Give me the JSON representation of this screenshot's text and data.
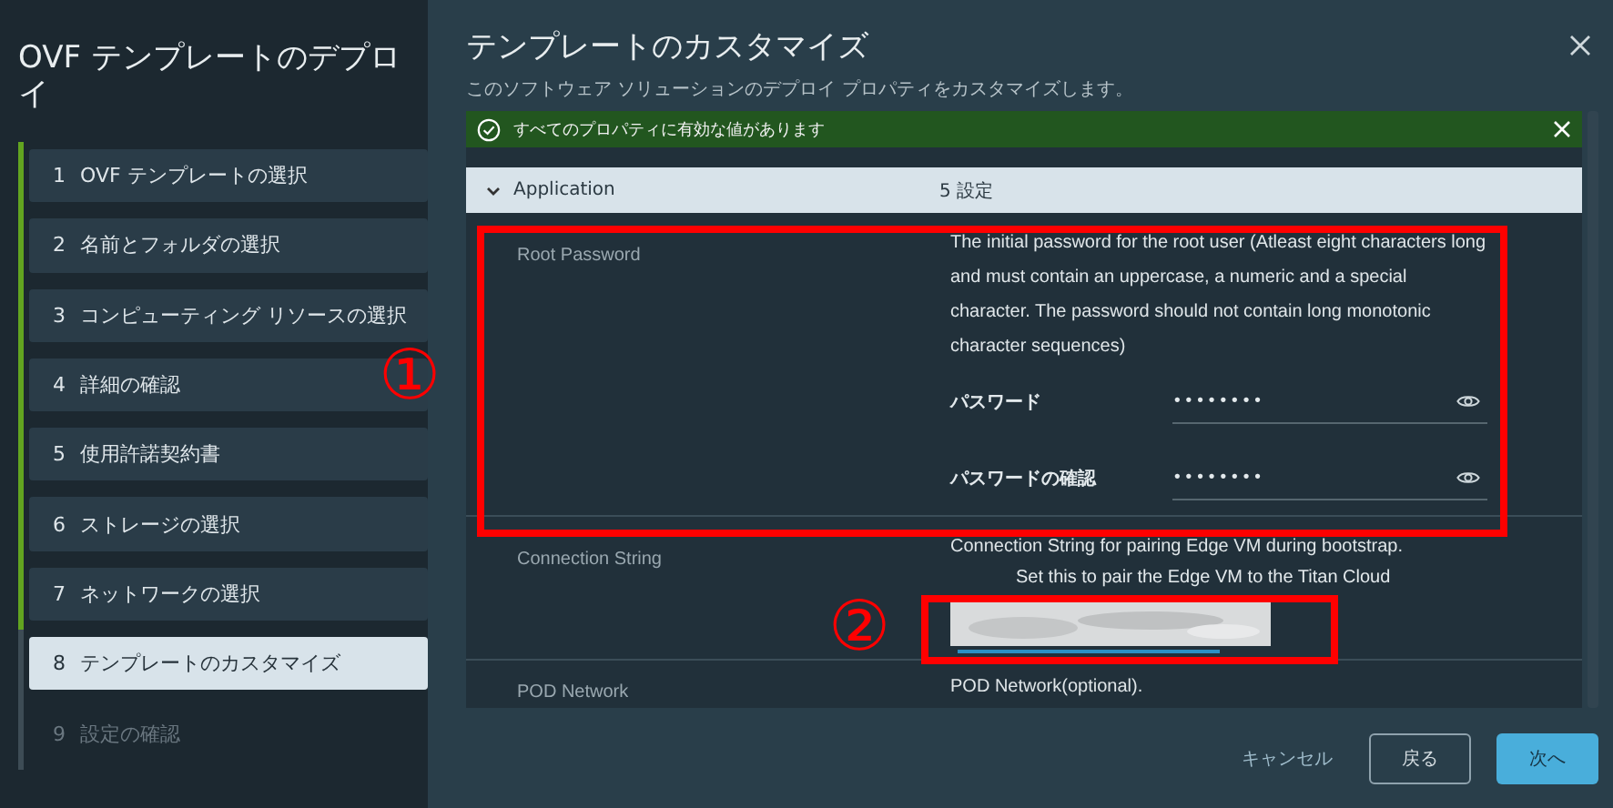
{
  "wizard": {
    "title": "OVF テンプレートのデプロイ",
    "steps": [
      {
        "number": "1",
        "label": "OVF テンプレートの選択",
        "selected": false,
        "completed": true,
        "disabled": false
      },
      {
        "number": "2",
        "label": "名前とフォルダの選択",
        "selected": false,
        "completed": true,
        "disabled": false
      },
      {
        "number": "3",
        "label": "コンピューティング リソースの選択",
        "selected": false,
        "completed": true,
        "disabled": false
      },
      {
        "number": "4",
        "label": "詳細の確認",
        "selected": false,
        "completed": true,
        "disabled": false
      },
      {
        "number": "5",
        "label": "使用許諾契約書",
        "selected": false,
        "completed": true,
        "disabled": false
      },
      {
        "number": "6",
        "label": "ストレージの選択",
        "selected": false,
        "completed": true,
        "disabled": false
      },
      {
        "number": "7",
        "label": "ネットワークの選択",
        "selected": false,
        "completed": true,
        "disabled": false
      },
      {
        "number": "8",
        "label": "テンプレートのカスタマイズ",
        "selected": true,
        "completed": false,
        "disabled": false
      },
      {
        "number": "9",
        "label": "設定の確認",
        "selected": false,
        "completed": false,
        "disabled": true
      }
    ]
  },
  "page": {
    "title": "テンプレートのカスタマイズ",
    "subtitle": "このソフトウェア ソリューションのデプロイ プロパティをカスタマイズします。"
  },
  "banner": {
    "text": "すべてのプロパティに有効な値があります"
  },
  "section": {
    "name": "Application",
    "count": "5 設定",
    "expanded": true
  },
  "properties": [
    {
      "kind": "password",
      "label": "Root Password",
      "description": "The initial password for the root user (Atleast eight characters long and must contain an uppercase, a numeric and a special character. The password should not contain long monotonic character sequences)",
      "fields": [
        {
          "label": "パスワード",
          "value": "••••••••"
        },
        {
          "label": "パスワードの確認",
          "value": "••••••••"
        }
      ]
    },
    {
      "kind": "redacted",
      "label": "Connection String",
      "description": "Connection String for pairing Edge VM during bootstrap.",
      "note": "Set this to pair the Edge VM to the Titan Cloud"
    },
    {
      "kind": "text",
      "label": "POD Network",
      "description": "POD Network(optional)."
    }
  ],
  "annotations": [
    {
      "mark": "①"
    },
    {
      "mark": "②"
    }
  ],
  "buttons": [
    {
      "label": "キャンセル",
      "kind": "link"
    },
    {
      "label": "戻る",
      "kind": "outline"
    },
    {
      "label": "次へ",
      "kind": "primary"
    }
  ]
}
